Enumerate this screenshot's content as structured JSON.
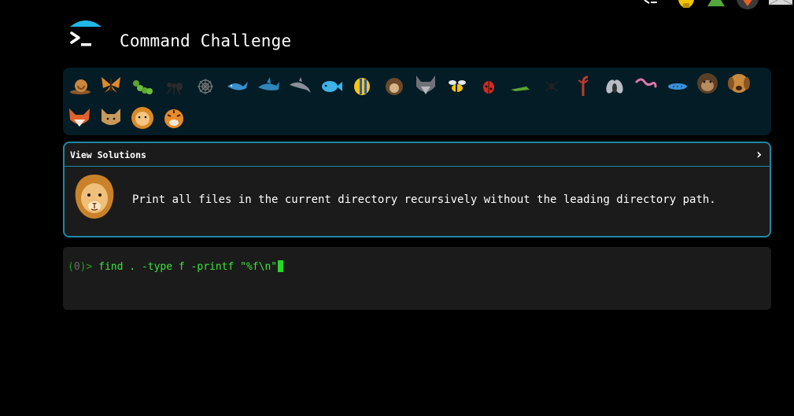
{
  "app": {
    "title": "Command Challenge"
  },
  "levels": [
    {
      "name": "snail"
    },
    {
      "name": "butterfly"
    },
    {
      "name": "caterpillar"
    },
    {
      "name": "ant"
    },
    {
      "name": "spider-web"
    },
    {
      "name": "whale"
    },
    {
      "name": "shark"
    },
    {
      "name": "dolphin"
    },
    {
      "name": "fish"
    },
    {
      "name": "tropical-fish"
    },
    {
      "name": "hedgehog"
    },
    {
      "name": "wolf"
    },
    {
      "name": "bee"
    },
    {
      "name": "ladybug"
    },
    {
      "name": "grasshopper"
    },
    {
      "name": "spider"
    },
    {
      "name": "scorpion"
    },
    {
      "name": "fly"
    },
    {
      "name": "worm"
    },
    {
      "name": "microbe"
    },
    {
      "name": "monkey"
    },
    {
      "name": "dog"
    },
    {
      "name": "fox"
    },
    {
      "name": "cat"
    },
    {
      "name": "lion"
    },
    {
      "name": "tiger"
    }
  ],
  "challenge": {
    "header_label": "View Solutions",
    "description": "Print all files in the current directory recursively without the leading directory path.",
    "avatar_icon": "lion-icon"
  },
  "terminal": {
    "prompt_open": "(",
    "prompt_zero": "0",
    "prompt_close": ")> ",
    "command": "find . -type f -printf \"%f\\n\""
  },
  "colors": {
    "accent": "#1f87a6",
    "strip_bg": "#041c25",
    "terminal_text": "#39e63a"
  }
}
